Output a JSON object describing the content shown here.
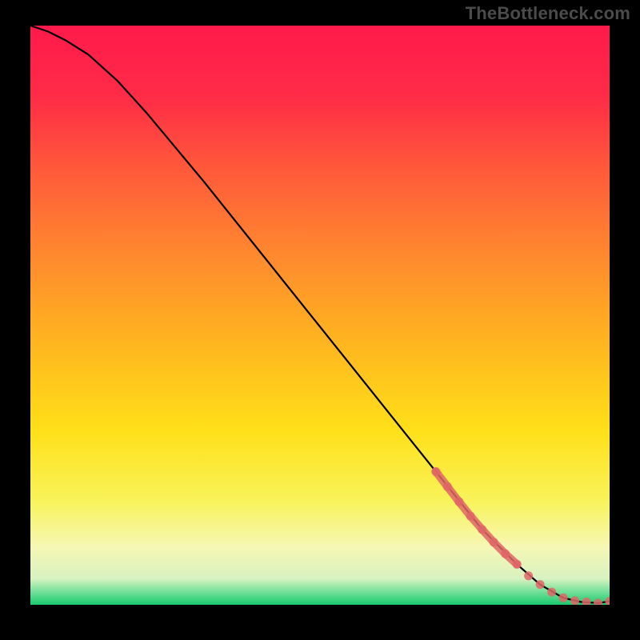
{
  "attribution": "TheBottleneck.com",
  "chart_data": {
    "type": "line",
    "title": "",
    "xlabel": "",
    "ylabel": "",
    "xlim": [
      0,
      100
    ],
    "ylim": [
      0,
      100
    ],
    "background_gradient": {
      "stops": [
        {
          "offset": 0.0,
          "color": "#ff1a4b"
        },
        {
          "offset": 0.12,
          "color": "#ff2b47"
        },
        {
          "offset": 0.25,
          "color": "#ff5a3a"
        },
        {
          "offset": 0.4,
          "color": "#ff8a2e"
        },
        {
          "offset": 0.55,
          "color": "#ffb61f"
        },
        {
          "offset": 0.7,
          "color": "#ffe019"
        },
        {
          "offset": 0.82,
          "color": "#f8f35a"
        },
        {
          "offset": 0.9,
          "color": "#f6f7b4"
        },
        {
          "offset": 0.955,
          "color": "#d8f2c0"
        },
        {
          "offset": 0.975,
          "color": "#7de39c"
        },
        {
          "offset": 1.0,
          "color": "#18c96f"
        }
      ]
    },
    "series": [
      {
        "name": "curve",
        "type": "line",
        "color": "#000000",
        "x": [
          0,
          3,
          6,
          10,
          15,
          20,
          30,
          40,
          50,
          60,
          70,
          78,
          84,
          88,
          92,
          95,
          98,
          100
        ],
        "y": [
          100,
          99,
          97.5,
          95,
          90.5,
          85,
          73,
          60.5,
          48,
          35.5,
          23,
          13,
          7,
          3.5,
          1.2,
          0.5,
          0.3,
          0.6
        ]
      },
      {
        "name": "highlight-segment",
        "type": "line",
        "color": "#e06666",
        "thick": true,
        "x": [
          70,
          72,
          74,
          76,
          78,
          80,
          82,
          84
        ],
        "y": [
          23,
          20.4,
          17.8,
          15.3,
          13,
          10.8,
          8.8,
          7
        ]
      },
      {
        "name": "dots",
        "type": "scatter",
        "color": "#e06666",
        "x": [
          70,
          72,
          74,
          76,
          78,
          80,
          82,
          84,
          86,
          88,
          90,
          92,
          94,
          96,
          98,
          100
        ],
        "y": [
          23,
          20.4,
          17.8,
          15.3,
          13,
          10.8,
          8.8,
          7,
          5,
          3.5,
          2.2,
          1.2,
          0.7,
          0.5,
          0.3,
          0.6
        ]
      }
    ]
  }
}
